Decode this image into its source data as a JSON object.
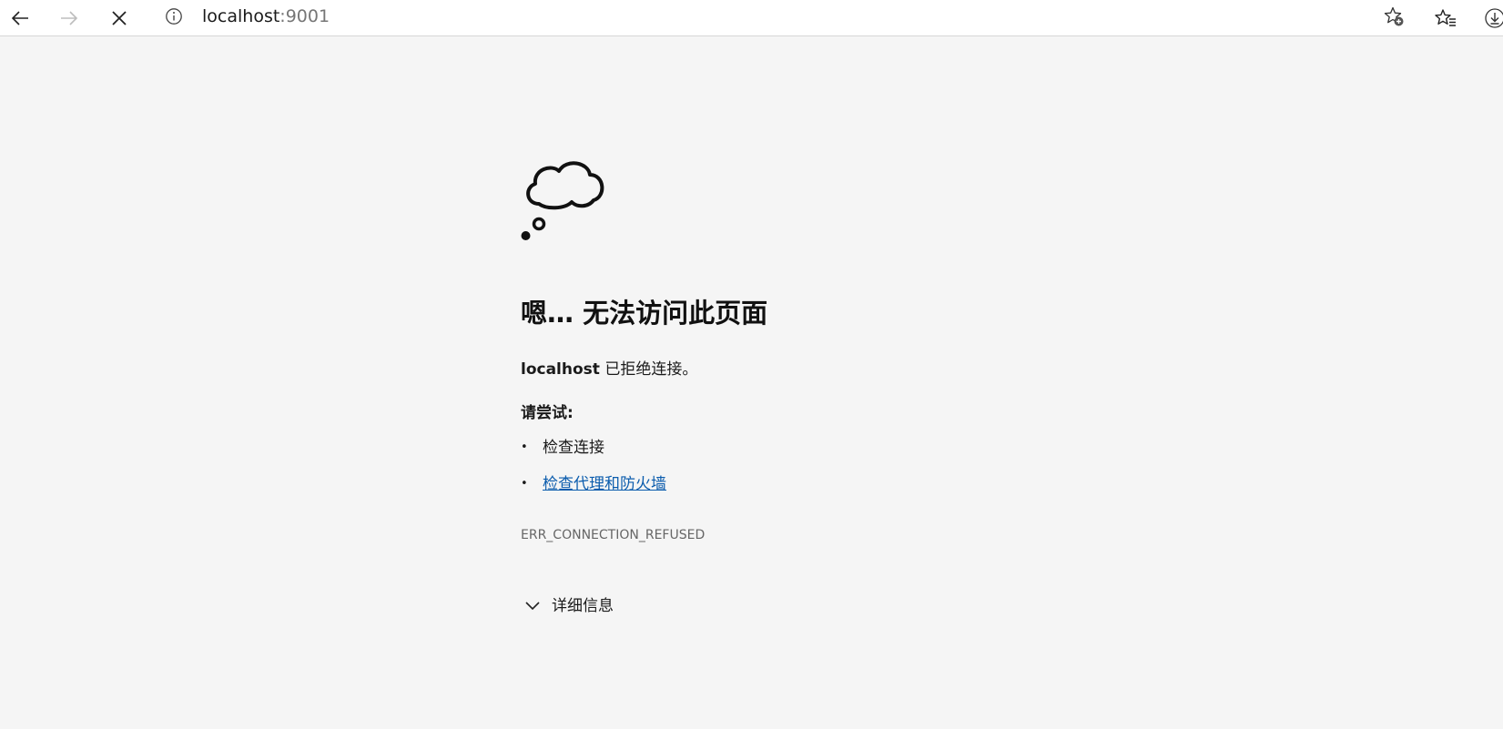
{
  "browser": {
    "address": {
      "host": "localhost",
      "port": ":9001"
    },
    "icons": {
      "back": "arrow-left-icon",
      "forward": "arrow-right-icon",
      "stop": "close-icon",
      "site_info": "info-icon",
      "add_favorite": "star-add-icon",
      "favorites": "favorites-list-icon",
      "downloads": "download-icon"
    }
  },
  "error_page": {
    "title": "嗯… 无法访问此页面",
    "host": "localhost",
    "message": " 已拒绝连接。",
    "try_label": "请尝试:",
    "suggestions": {
      "check_connection": "检查连接",
      "check_proxy_firewall": "检查代理和防火墙"
    },
    "error_code": "ERR_CONNECTION_REFUSED",
    "details_label": "详细信息"
  },
  "colors": {
    "page_background": "#f5f5f5",
    "link": "#0b5cad",
    "muted_text": "#666666"
  }
}
